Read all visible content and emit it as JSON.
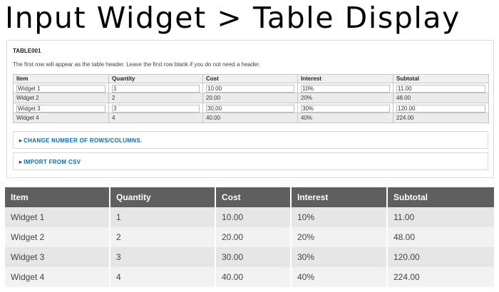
{
  "page_title": "Input Widget > Table Display",
  "widget": {
    "field_id": "TABLE001",
    "help_text": "The first row will appear as the table header. Leave the first row blank if you do not need a header.",
    "headers": [
      "Item",
      "Quantity",
      "Cost",
      "Interest",
      "Subtotal"
    ],
    "rows": [
      [
        "Widget 1",
        "1",
        "10.00",
        "10%",
        "11.00"
      ],
      [
        "Widget 2",
        "2",
        "20.00",
        "20%",
        "48.00"
      ],
      [
        "Widget 3",
        "3",
        "30.00",
        "30%",
        "120.00"
      ],
      [
        "Widget 4",
        "4",
        "40.00",
        "40%",
        "224.00"
      ]
    ],
    "change_rows_label": "Change number of rows/columns.",
    "import_csv_label": "Import from CSV",
    "collapsed_marker": "▶"
  },
  "display": {
    "headers": [
      "Item",
      "Quantity",
      "Cost",
      "Interest",
      "Subtotal"
    ],
    "rows": [
      [
        "Widget 1",
        "1",
        "10.00",
        "10%",
        "11.00"
      ],
      [
        "Widget 2",
        "2",
        "20.00",
        "20%",
        "48.00"
      ],
      [
        "Widget 3",
        "3",
        "30.00",
        "30%",
        "120.00"
      ],
      [
        "Widget 4",
        "4",
        "40.00",
        "40%",
        "224.00"
      ]
    ]
  },
  "colors": {
    "link": "#0a6aa0",
    "display_header_bg": "#5f5f5f"
  }
}
